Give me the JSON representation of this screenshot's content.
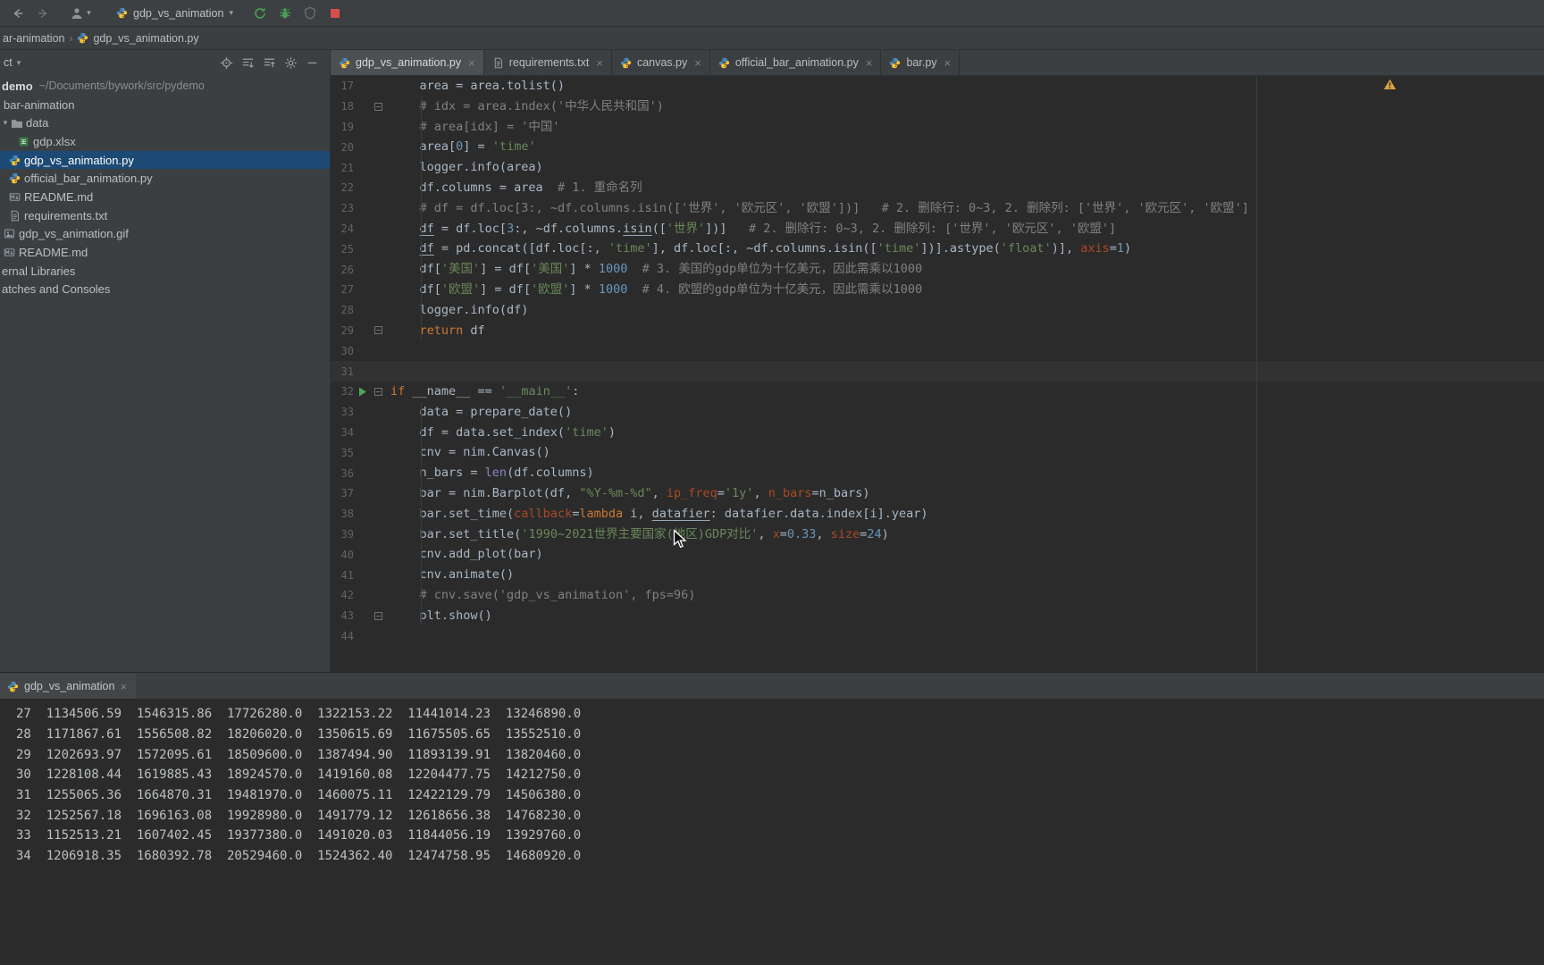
{
  "toolbar": {
    "run_config": "gdp_vs_animation"
  },
  "breadcrumbs": {
    "folder": "ar-animation",
    "file": "gdp_vs_animation.py"
  },
  "project": {
    "header": "ct",
    "tree": [
      {
        "label": "demo",
        "sublabel": "~/Documents/bywork/src/pydemo",
        "icon": "none",
        "level": 0,
        "bold": true
      },
      {
        "label": "bar-animation",
        "icon": "none",
        "level": 1
      },
      {
        "label": "data",
        "icon": "folder",
        "level": 2,
        "chevron": true
      },
      {
        "label": "gdp.xlsx",
        "icon": "excel",
        "level": 3
      },
      {
        "label": "gdp_vs_animation.py",
        "icon": "python",
        "level": 2,
        "selected": true
      },
      {
        "label": "official_bar_animation.py",
        "icon": "python",
        "level": 2
      },
      {
        "label": "README.md",
        "icon": "markdown",
        "level": 2
      },
      {
        "label": "requirements.txt",
        "icon": "textfile",
        "level": 2
      },
      {
        "label": "gdp_vs_animation.gif",
        "icon": "image",
        "level": 1
      },
      {
        "label": "README.md",
        "icon": "markdown",
        "level": 1
      },
      {
        "label": "ernal Libraries",
        "icon": "none",
        "level": 0
      },
      {
        "label": "atches and Consoles",
        "icon": "none",
        "level": 0
      }
    ]
  },
  "editor": {
    "tabs": [
      {
        "label": "gdp_vs_animation.py",
        "icon": "python",
        "active": true
      },
      {
        "label": "requirements.txt",
        "icon": "textfile",
        "active": false
      },
      {
        "label": "canvas.py",
        "icon": "python",
        "active": false
      },
      {
        "label": "official_bar_animation.py",
        "icon": "python",
        "active": false
      },
      {
        "label": "bar.py",
        "icon": "python",
        "active": false
      }
    ],
    "lines": [
      {
        "n": 17,
        "t": [
          [
            "pl",
            "    area = area.tolist()"
          ]
        ]
      },
      {
        "n": 18,
        "fold": true,
        "t": [
          [
            "pl",
            "    "
          ],
          [
            "com",
            "# idx = area.index('中华人民共和国')"
          ]
        ]
      },
      {
        "n": 19,
        "t": [
          [
            "pl",
            "    "
          ],
          [
            "com",
            "# area[idx] = '中国'"
          ]
        ]
      },
      {
        "n": 20,
        "t": [
          [
            "pl",
            "    area["
          ],
          [
            "num",
            "0"
          ],
          [
            "pl",
            "] = "
          ],
          [
            "str",
            "'time'"
          ]
        ]
      },
      {
        "n": 21,
        "t": [
          [
            "pl",
            "    logger.info(area)"
          ]
        ]
      },
      {
        "n": 22,
        "t": [
          [
            "pl",
            "    df.columns = area  "
          ],
          [
            "com",
            "# 1. 重命名列"
          ]
        ]
      },
      {
        "n": 23,
        "t": [
          [
            "pl",
            "    "
          ],
          [
            "com",
            "# df = df.loc[3:, ~df.columns.isin(['世界', '欧元区', '欧盟'])]   # 2. 删除行: 0~3, 2. 删除列: ['世界', '欧元区', '欧盟']"
          ]
        ]
      },
      {
        "n": 24,
        "t": [
          [
            "pl",
            "    "
          ],
          [
            "und",
            "df"
          ],
          [
            "pl",
            " = df.loc["
          ],
          [
            "num",
            "3"
          ],
          [
            "pl",
            ":, ~df.columns."
          ],
          [
            "und",
            "isin"
          ],
          [
            "pl",
            "(["
          ],
          [
            "str",
            "'世界'"
          ],
          [
            "pl",
            "])]   "
          ],
          [
            "com",
            "# 2. 删除行: 0~3, 2. 删除列: ['世界', '欧元区', '欧盟']"
          ]
        ]
      },
      {
        "n": 25,
        "t": [
          [
            "pl",
            "    "
          ],
          [
            "und",
            "df"
          ],
          [
            "pl",
            " = pd.concat([df.loc[:, "
          ],
          [
            "str",
            "'time'"
          ],
          [
            "pl",
            "], df.loc[:, ~df.columns.isin(["
          ],
          [
            "str",
            "'time'"
          ],
          [
            "pl",
            "])].astype("
          ],
          [
            "str",
            "'float'"
          ],
          [
            "pl",
            ")], "
          ],
          [
            "arg",
            "axis"
          ],
          [
            "pl",
            "="
          ],
          [
            "num",
            "1"
          ],
          [
            "pl",
            ")"
          ]
        ]
      },
      {
        "n": 26,
        "t": [
          [
            "pl",
            "    df["
          ],
          [
            "str",
            "'美国'"
          ],
          [
            "pl",
            "] = df["
          ],
          [
            "str",
            "'美国'"
          ],
          [
            "pl",
            "] * "
          ],
          [
            "num",
            "1000"
          ],
          [
            "pl",
            "  "
          ],
          [
            "com",
            "# 3. 美国的gdp单位为十亿美元，因此需乘以1000"
          ]
        ]
      },
      {
        "n": 27,
        "t": [
          [
            "pl",
            "    df["
          ],
          [
            "str",
            "'欧盟'"
          ],
          [
            "pl",
            "] = df["
          ],
          [
            "str",
            "'欧盟'"
          ],
          [
            "pl",
            "] * "
          ],
          [
            "num",
            "1000"
          ],
          [
            "pl",
            "  "
          ],
          [
            "com",
            "# 4. 欧盟的gdp单位为十亿美元，因此需乘以1000"
          ]
        ]
      },
      {
        "n": 28,
        "t": [
          [
            "pl",
            "    logger.info(df)"
          ]
        ]
      },
      {
        "n": 29,
        "fold": true,
        "t": [
          [
            "pl",
            "    "
          ],
          [
            "kw",
            "return"
          ],
          [
            "pl",
            " df"
          ]
        ]
      },
      {
        "n": 30,
        "t": []
      },
      {
        "n": 31,
        "active": true,
        "t": []
      },
      {
        "n": 32,
        "run": true,
        "fold": true,
        "t": [
          [
            "kw",
            "if "
          ],
          [
            "pl",
            "__name__ == "
          ],
          [
            "str",
            "'__main__'"
          ],
          [
            "pl",
            ":"
          ]
        ]
      },
      {
        "n": 33,
        "t": [
          [
            "pl",
            "    data = prepare_date()"
          ]
        ]
      },
      {
        "n": 34,
        "t": [
          [
            "pl",
            "    df = data.set_index("
          ],
          [
            "str",
            "'time'"
          ],
          [
            "pl",
            ")"
          ]
        ]
      },
      {
        "n": 35,
        "t": [
          [
            "pl",
            "    cnv = nim.Canvas()"
          ]
        ]
      },
      {
        "n": 36,
        "t": [
          [
            "pl",
            "    n_bars = "
          ],
          [
            "bi",
            "len"
          ],
          [
            "pl",
            "(df.columns)"
          ]
        ]
      },
      {
        "n": 37,
        "t": [
          [
            "pl",
            "    bar = nim.Barplot(df, "
          ],
          [
            "str",
            "\"%Y-%m-%d\""
          ],
          [
            "pl",
            ", "
          ],
          [
            "arg",
            "ip_freq"
          ],
          [
            "pl",
            "="
          ],
          [
            "str",
            "'1y'"
          ],
          [
            "pl",
            ", "
          ],
          [
            "arg",
            "n_bars"
          ],
          [
            "pl",
            "=n_bars)"
          ]
        ]
      },
      {
        "n": 38,
        "t": [
          [
            "pl",
            "    bar.set_time("
          ],
          [
            "arg",
            "callback"
          ],
          [
            "pl",
            "="
          ],
          [
            "kw",
            "lambda "
          ],
          [
            "pl",
            "i, "
          ],
          [
            "und",
            "datafier"
          ],
          [
            "pl",
            ": datafier.data.index[i].year)"
          ]
        ]
      },
      {
        "n": 39,
        "t": [
          [
            "pl",
            "    bar.set_title("
          ],
          [
            "str",
            "'1990~2021世界主要国家(地区)GDP对比'"
          ],
          [
            "pl",
            ", "
          ],
          [
            "arg",
            "x"
          ],
          [
            "pl",
            "="
          ],
          [
            "num",
            "0.33"
          ],
          [
            "pl",
            ", "
          ],
          [
            "arg",
            "size"
          ],
          [
            "pl",
            "="
          ],
          [
            "num",
            "24"
          ],
          [
            "pl",
            ")"
          ]
        ]
      },
      {
        "n": 40,
        "t": [
          [
            "pl",
            "    cnv.add_plot(bar)"
          ]
        ]
      },
      {
        "n": 41,
        "t": [
          [
            "pl",
            "    cnv.animate()"
          ]
        ]
      },
      {
        "n": 42,
        "t": [
          [
            "pl",
            "    "
          ],
          [
            "com",
            "# cnv.save('gdp_vs_animation', fps=96)"
          ]
        ]
      },
      {
        "n": 43,
        "fold": true,
        "t": [
          [
            "pl",
            "    plt.show()"
          ]
        ]
      },
      {
        "n": 44,
        "t": []
      }
    ]
  },
  "console": {
    "tab": "gdp_vs_animation",
    "rows": [
      "27  1134506.59  1546315.86  17726280.0  1322153.22  11441014.23  13246890.0",
      "28  1171867.61  1556508.82  18206020.0  1350615.69  11675505.65  13552510.0",
      "29  1202693.97  1572095.61  18509600.0  1387494.90  11893139.91  13820460.0",
      "30  1228108.44  1619885.43  18924570.0  1419160.08  12204477.75  14212750.0",
      "31  1255065.36  1664870.31  19481970.0  1460075.11  12422129.79  14506380.0",
      "32  1252567.18  1696163.08  19928980.0  1491779.12  12618656.38  14768230.0",
      "33  1152513.21  1607402.45  19377380.0  1491020.03  11844056.19  13929760.0",
      "34  1206918.35  1680392.78  20529460.0  1524362.40  12474758.95  14680920.0"
    ]
  },
  "colors": {
    "run_green": "#499c54",
    "stop_red": "#d64f4f",
    "warning_yellow": "#d9a343",
    "selection_blue": "#1c4a74",
    "keyword_orange": "#cc7832",
    "string_green": "#6a8759",
    "number_blue": "#6897bb",
    "comment_gray": "#808080",
    "named_arg_rust": "#aa4926"
  }
}
